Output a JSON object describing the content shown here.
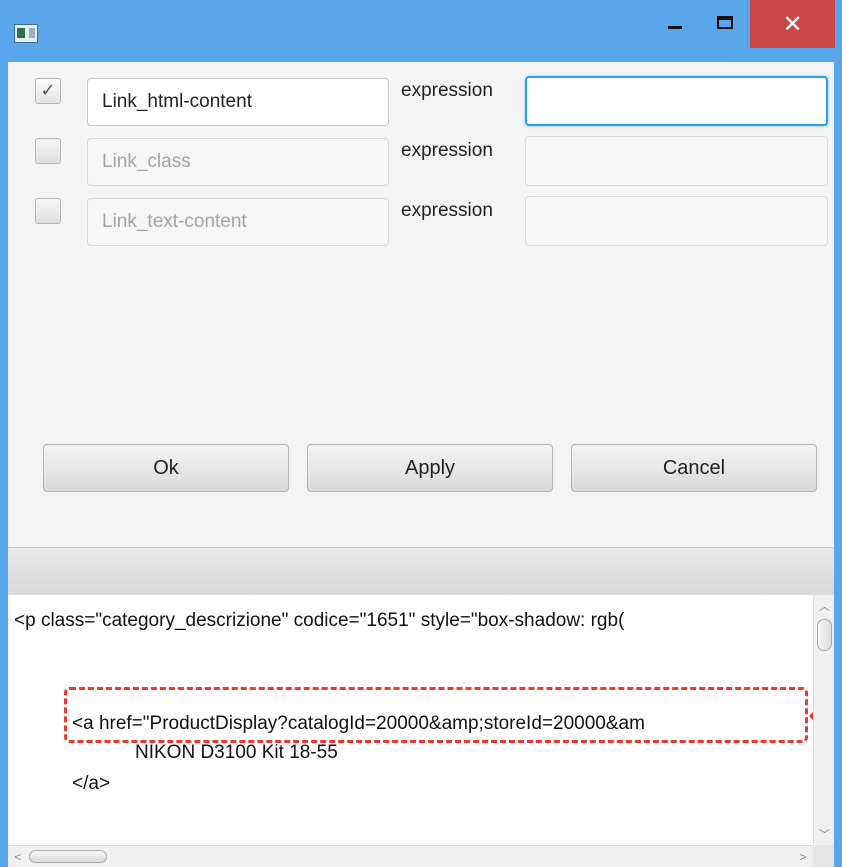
{
  "titlebar": {
    "app_icon": "window-app-icon",
    "minimize_icon": "minimize-icon",
    "maximize_icon": "maximize-icon",
    "close_icon": "close-icon",
    "close_glyph": "✕"
  },
  "rows": [
    {
      "checked": true,
      "name": "Link_html-content",
      "expr_label": "expression",
      "expr_value": "",
      "enabled": true,
      "focused": true
    },
    {
      "checked": false,
      "name": "Link_class",
      "expr_label": "expression",
      "expr_value": "",
      "enabled": false,
      "focused": false
    },
    {
      "checked": false,
      "name": "Link_text-content",
      "expr_label": "expression",
      "expr_value": "",
      "enabled": false,
      "focused": false
    }
  ],
  "buttons": {
    "ok": "Ok",
    "apply": "Apply",
    "cancel": "Cancel"
  },
  "code": {
    "line1": "<p class=\"category_descrizione\" codice=\"1651\" style=\"box-shadow: rgb(",
    "line2": "<a href=\"ProductDisplay?catalogId=20000&amp;storeId=20000&am",
    "line3": "NIKON D3100 Kit 18-55",
    "line4": "</a>"
  },
  "annotation": {
    "highlight_color": "#e8392e",
    "arrow_icon": "left-arrow-icon"
  },
  "colors": {
    "titlebar": "#5aa6ea",
    "close_button": "#c94747",
    "focus_border": "#2a9ff0"
  }
}
